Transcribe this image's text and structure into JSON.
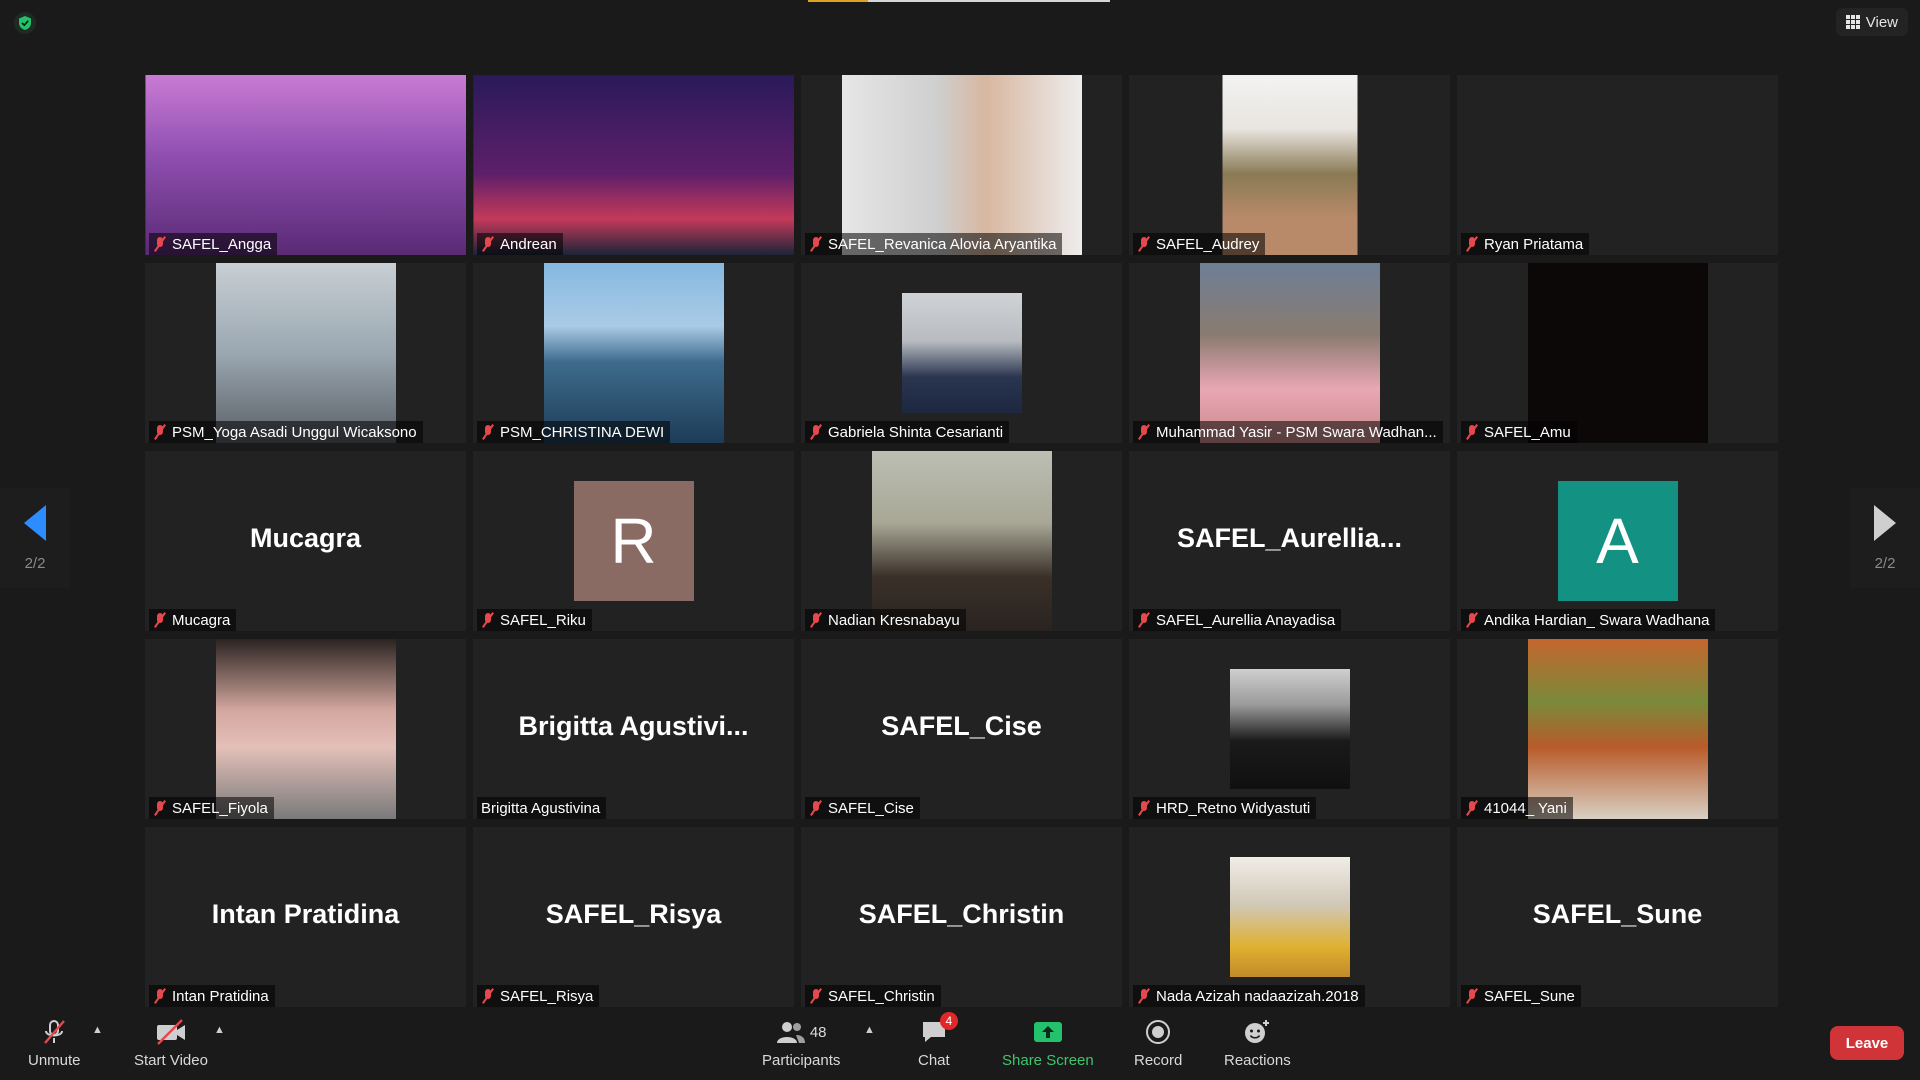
{
  "toolbar_top": {
    "view_label": "View"
  },
  "pager": {
    "left_count": "2/2",
    "right_count": "2/2"
  },
  "participants": [
    {
      "name": "SAFEL_Angga",
      "big_name": ""
    },
    {
      "name": "Andrean",
      "big_name": ""
    },
    {
      "name": "SAFEL_Revanica Alovia Aryantika",
      "big_name": ""
    },
    {
      "name": "SAFEL_Audrey",
      "big_name": ""
    },
    {
      "name": "Ryan Priatama",
      "big_name": ""
    },
    {
      "name": "PSM_Yoga Asadi Unggul Wicaksono",
      "big_name": ""
    },
    {
      "name": "PSM_CHRISTINA DEWI",
      "big_name": ""
    },
    {
      "name": "Gabriela Shinta Cesarianti",
      "big_name": ""
    },
    {
      "name": "Muhammad Yasir - PSM Swara Wadhan...",
      "big_name": ""
    },
    {
      "name": "SAFEL_Amu",
      "big_name": ""
    },
    {
      "name": "Mucagra",
      "big_name": "Mucagra"
    },
    {
      "name": "SAFEL_Riku",
      "big_name": "",
      "avatar": "R"
    },
    {
      "name": "Nadian Kresnabayu",
      "big_name": ""
    },
    {
      "name": "SAFEL_Aurellia Anayadisa",
      "big_name": "SAFEL_Aurellia..."
    },
    {
      "name": "Andika Hardian_ Swara Wadhana",
      "big_name": "",
      "avatar": "A"
    },
    {
      "name": "SAFEL_Fiyola",
      "big_name": ""
    },
    {
      "name": "Brigitta Agustivina",
      "big_name": "Brigitta  Agustivi..."
    },
    {
      "name": "SAFEL_Cise",
      "big_name": "SAFEL_Cise"
    },
    {
      "name": "HRD_Retno Widyastuti",
      "big_name": ""
    },
    {
      "name": "41044_ Yani",
      "big_name": ""
    },
    {
      "name": "Intan Pratidina",
      "big_name": "Intan Pratidina"
    },
    {
      "name": "SAFEL_Risya",
      "big_name": "SAFEL_Risya"
    },
    {
      "name": "SAFEL_Christin",
      "big_name": "SAFEL_Christin"
    },
    {
      "name": "Nada Azizah nadaazizah.2018",
      "big_name": ""
    },
    {
      "name": "SAFEL_Sune",
      "big_name": "SAFEL_Sune"
    }
  ],
  "bottom_toolbar": {
    "unmute_label": "Unmute",
    "start_video_label": "Start Video",
    "participants_label": "Participants",
    "participants_count": "48",
    "chat_label": "Chat",
    "chat_badge": "4",
    "share_screen_label": "Share Screen",
    "record_label": "Record",
    "reactions_label": "Reactions",
    "leave_label": "Leave"
  },
  "colors": {
    "accent_blue": "#2d8cff",
    "share_green": "#3ec46d",
    "leave_red": "#d13438",
    "muted_red": "#e5484d",
    "avatar_r": "#8a6b64",
    "avatar_a": "#139283"
  }
}
